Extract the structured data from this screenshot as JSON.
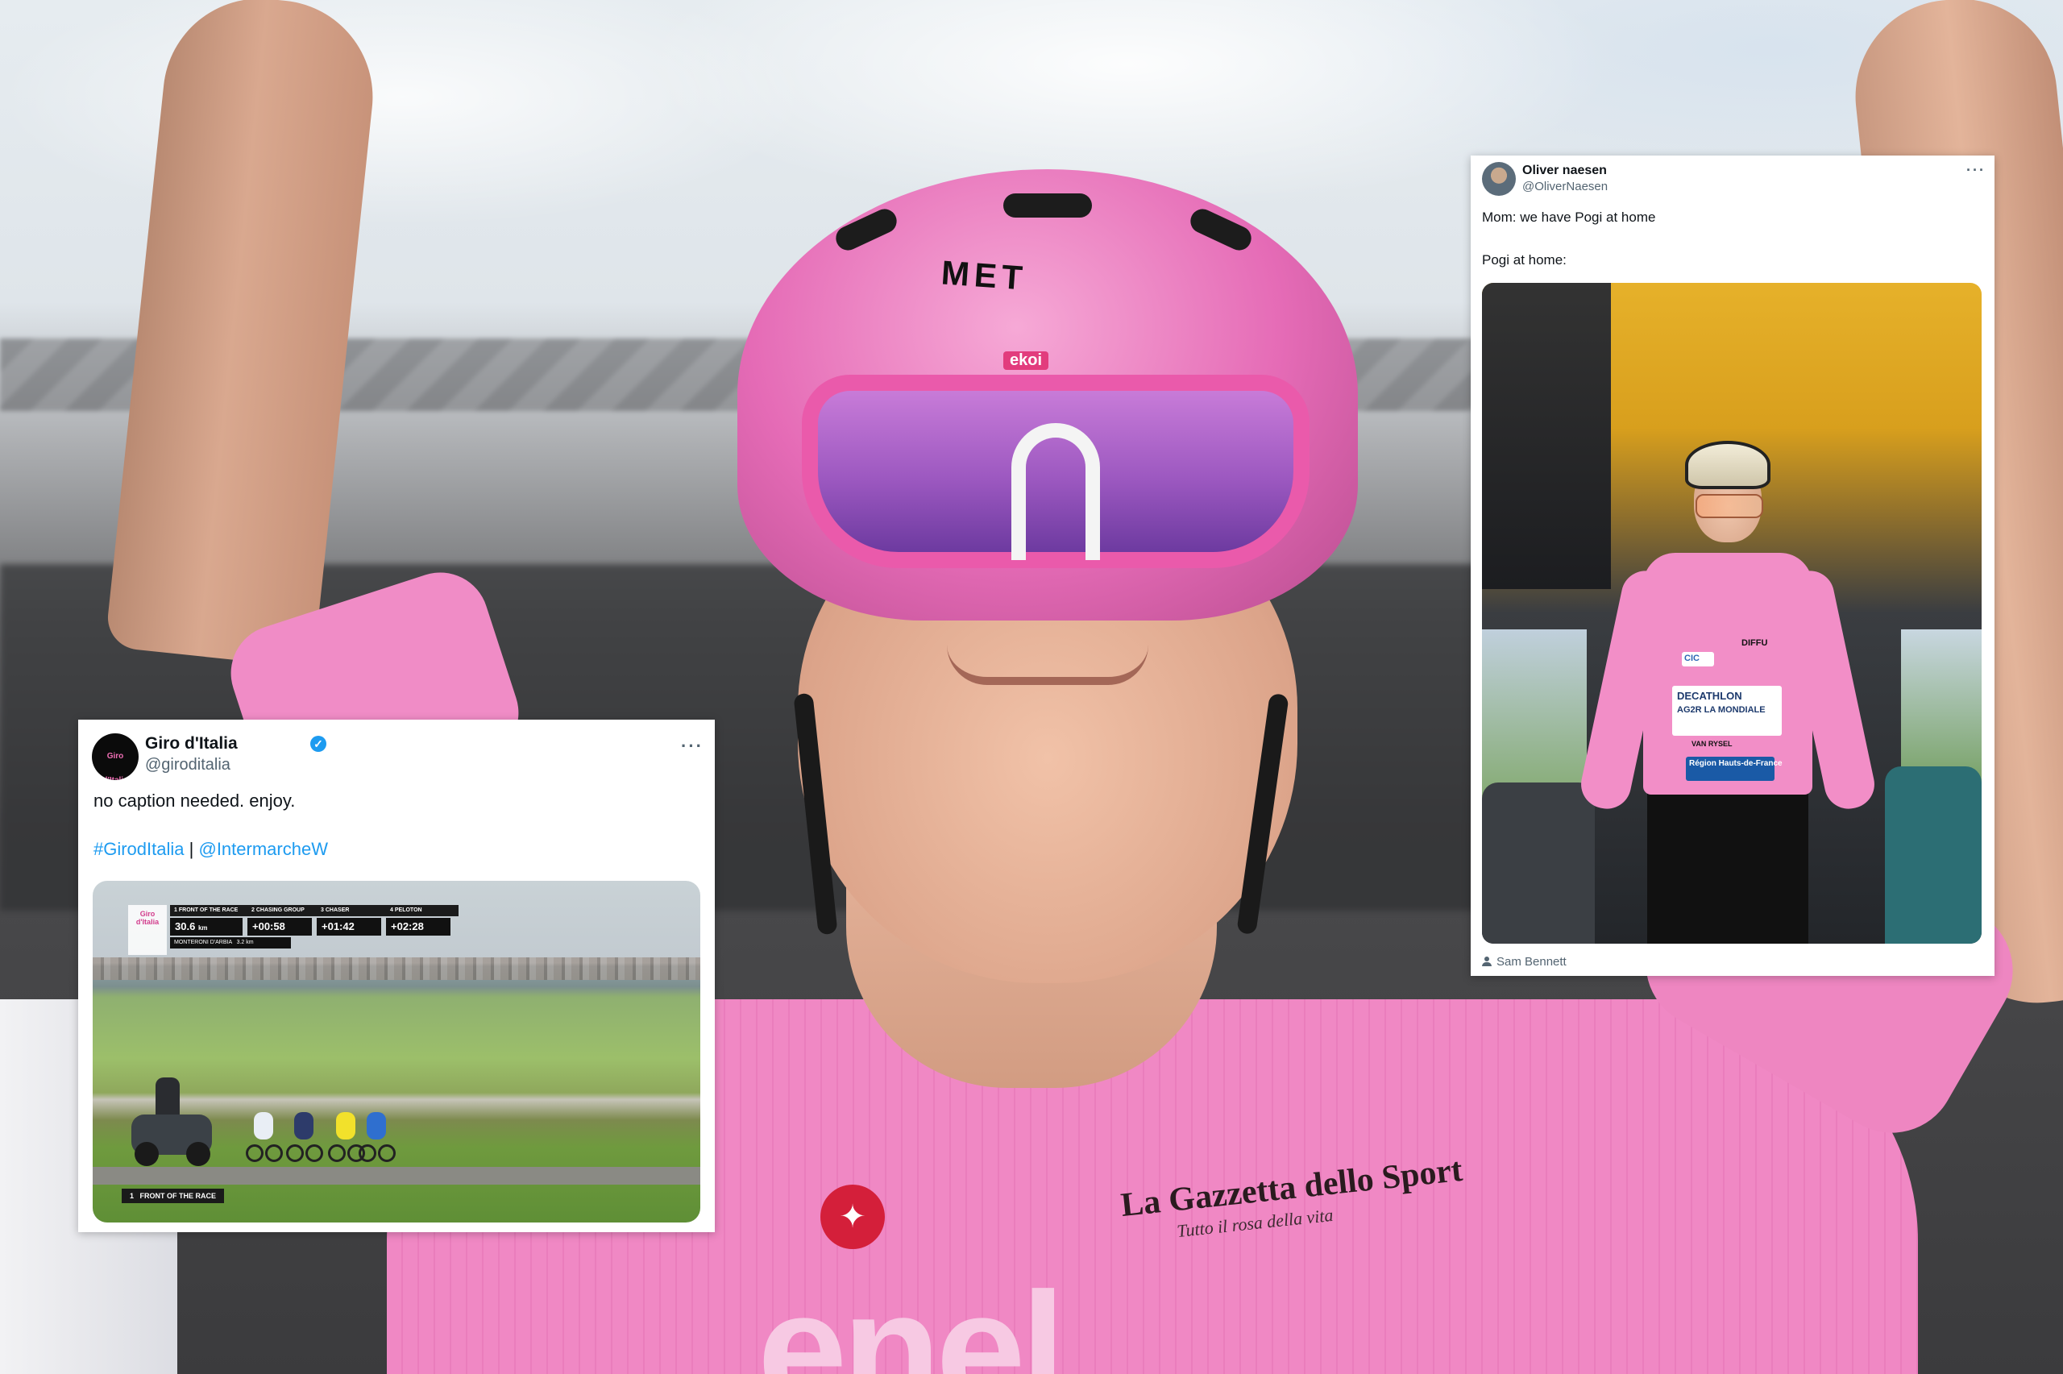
{
  "background": {
    "helmet_brand": "MET",
    "glasses_brand": "ekoi",
    "jersey_sponsor": "La Gazzetta dello Sport",
    "jersey_tagline": "Tutto il rosa della vita",
    "jersey_chest_sponsor": "enel"
  },
  "tweet_left": {
    "display_name": "Giro d'Italia",
    "handle": "@giroditalia",
    "verified": true,
    "avatar_icon": "giro-logo-icon",
    "avatar_logo_text": "Giro d'Italia",
    "more_label": "···",
    "text_line1": "no caption needed. enjoy.",
    "hashtag": "#GirodItalia",
    "separator": "|",
    "mention": "@IntermarcheW",
    "video_overlay": {
      "logo_text": "Giro d'Italia",
      "columns": [
        {
          "index": "1",
          "label": "FRONT OF THE RACE",
          "value": "30.6",
          "unit": "km"
        },
        {
          "index": "2",
          "label": "CHASING GROUP",
          "value": "+00:58"
        },
        {
          "index": "3",
          "label": "CHASER",
          "value": "+01:42"
        },
        {
          "index": "4",
          "label": "PELOTON",
          "value": "+02:28"
        }
      ],
      "sub_label": "MONTERONI D'ARBIA",
      "sub_value": "3.2 km",
      "lower_third_index": "1",
      "lower_third_label": "FRONT OF THE RACE"
    }
  },
  "tweet_right": {
    "display_name": "Oliver naesen",
    "handle": "@OliverNaesen",
    "more_label": "···",
    "text_line1": "Mom: we have Pogi at home",
    "text_line2": "Pogi at home:",
    "photo_credit": "Sam Bennett",
    "photo_sponsors": {
      "main": "DECATHLON",
      "sub": "AG2R LA MONDIALE",
      "region": "Région Hauts-de-France",
      "bank": "CIC",
      "brand": "DIFFU",
      "bike": "VAN RYSEL"
    }
  }
}
